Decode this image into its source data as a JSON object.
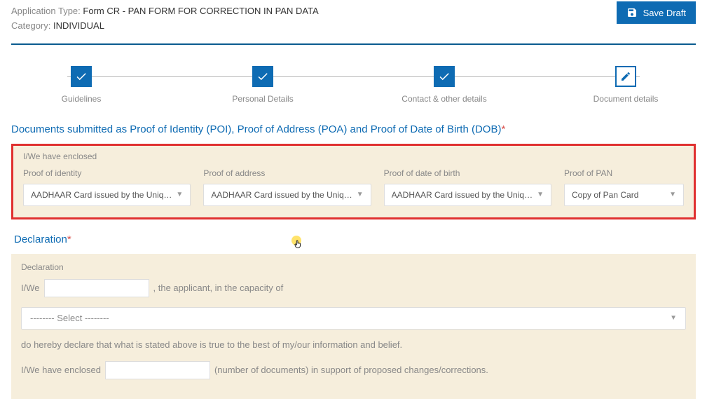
{
  "header": {
    "appTypeLabel": "Application Type: ",
    "appTypeValue": "Form CR - PAN FORM FOR CORRECTION IN PAN DATA",
    "categoryLabel": "Category: ",
    "categoryValue": "INDIVIDUAL",
    "saveDraft": "Save Draft"
  },
  "steps": [
    {
      "label": "Guidelines"
    },
    {
      "label": "Personal Details"
    },
    {
      "label": "Contact & other details"
    },
    {
      "label": "Document details"
    }
  ],
  "documents": {
    "title": "Documents submitted as Proof of Identity (POI), Proof of Address (POA) and Proof of Date of Birth (DOB)",
    "enclosed": "I/We have enclosed",
    "proofIdentityLabel": "Proof of identity",
    "proofIdentityValue": "AADHAAR Card issued by the Uniq…",
    "proofAddressLabel": "Proof of address",
    "proofAddressValue": "AADHAAR Card issued by the Uniq…",
    "proofDobLabel": "Proof of date of birth",
    "proofDobValue": "AADHAAR Card issued by the Uniq…",
    "proofPanLabel": "Proof of PAN",
    "proofPanValue": "Copy of Pan Card"
  },
  "declaration": {
    "title": "Declaration",
    "subtitle": "Declaration",
    "iwe": "I/We",
    "capacityText": ", the applicant, in the capacity of",
    "selectPlaceholder": "-------- Select --------",
    "declareText": "do hereby declare that what is stated above is true to the best of my/our information and belief.",
    "enclosedText1": "I/We have enclosed",
    "enclosedText2": "(number of documents) in support of proposed changes/corrections."
  }
}
